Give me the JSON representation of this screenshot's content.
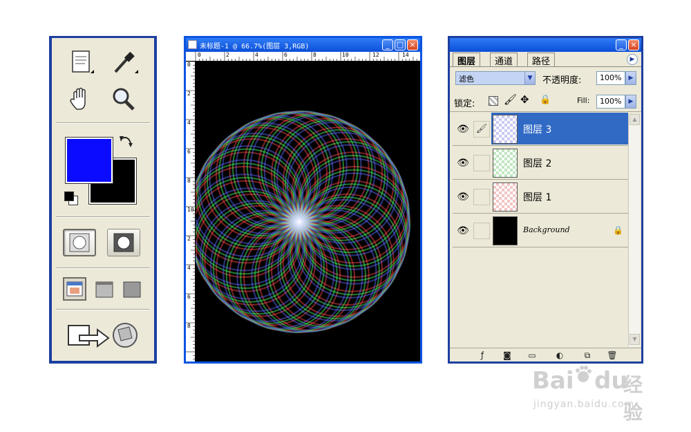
{
  "toolbox": {
    "tools": [
      "notes-tool",
      "eyedropper-tool",
      "hand-tool",
      "zoom-tool"
    ],
    "foreground_color": "#0b0bff",
    "background_color": "#000000",
    "mode_buttons": [
      "standard-mode",
      "quick-mask-mode"
    ],
    "screen_modes": [
      "standard-screen",
      "full-screen-menu",
      "full-screen"
    ],
    "jump_to": [
      "jump-to-imageready"
    ]
  },
  "document": {
    "title": "未标题-1 @ 66.7%(图层 3,RGB)",
    "ruler_top_labels": [
      "0",
      "2",
      "4",
      "6",
      "8",
      "10",
      "12",
      "14"
    ],
    "ruler_left_labels": [
      "0",
      "2",
      "4",
      "6",
      "8",
      "10",
      "2",
      "4",
      "6",
      "8"
    ],
    "window_buttons": [
      "_",
      "□",
      "×"
    ]
  },
  "layers_panel": {
    "tabs": [
      "图层",
      "通道",
      "路径"
    ],
    "blend_mode": "滤色",
    "opacity_label": "不透明度:",
    "opacity_value": "100%",
    "lock_label": "锁定:",
    "fill_label": "Fill:",
    "fill_value": "100%",
    "layers": [
      {
        "name": "图层 3",
        "selected": true,
        "thumb_color": "#8f8ff0"
      },
      {
        "name": "图层 2",
        "selected": false,
        "thumb_color": "#8fe08f"
      },
      {
        "name": "图层 1",
        "selected": false,
        "thumb_color": "#f08f8f"
      },
      {
        "name": "Background",
        "selected": false,
        "thumb_color": "#000000"
      }
    ]
  },
  "watermark": {
    "brand": "Bai",
    "brand2": "du",
    "cn": "经验",
    "url": "jingyan.baidu.com"
  }
}
